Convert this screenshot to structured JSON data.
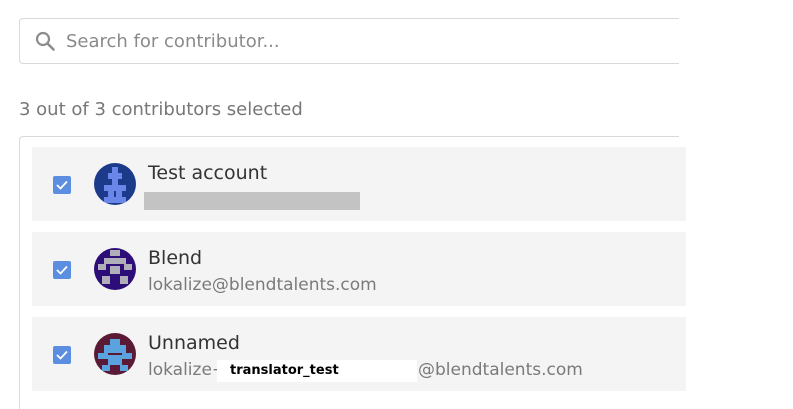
{
  "search": {
    "placeholder": "Search for contributor..."
  },
  "selection": {
    "summary": "3 out of 3 contributors selected"
  },
  "contributors": [
    {
      "name": "Test account",
      "email": "",
      "selected": true,
      "avatar_colors": [
        "#1c3a8a",
        "#6a86e8"
      ]
    },
    {
      "name": "Blend",
      "email": "lokalize@blendtalents.com",
      "selected": true,
      "avatar_colors": [
        "#2d0e78",
        "#b0aeb8"
      ]
    },
    {
      "name": "Unnamed",
      "email_prefix": "lokalize+",
      "email_handle": "translator_test",
      "email_suffix": "@blendtalents.com",
      "selected": true,
      "avatar_colors": [
        "#5a1a36",
        "#5aa3df"
      ]
    }
  ],
  "colors": {
    "checkbox": "#5b8ee0",
    "row_bg": "#f4f4f4",
    "border": "#d9d9d9"
  }
}
